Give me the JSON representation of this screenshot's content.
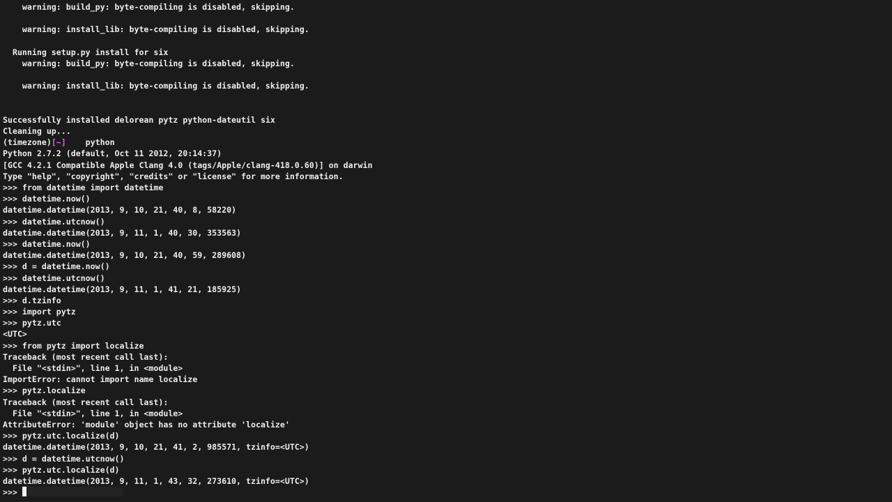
{
  "terminal": {
    "lines": [
      "    warning: build_py: byte-compiling is disabled, skipping.",
      "",
      "    warning: install_lib: byte-compiling is disabled, skipping.",
      "",
      "  Running setup.py install for six",
      "    warning: build_py: byte-compiling is disabled, skipping.",
      "",
      "    warning: install_lib: byte-compiling is disabled, skipping.",
      "",
      "",
      "Successfully installed delorean pytz python-dateutil six",
      "Cleaning up...",
      null,
      "Python 2.7.2 (default, Oct 11 2012, 20:14:37)",
      "[GCC 4.2.1 Compatible Apple Clang 4.0 (tags/Apple/clang-418.0.60)] on darwin",
      "Type \"help\", \"copyright\", \"credits\" or \"license\" for more information.",
      ">>> from datetime import datetime",
      ">>> datetime.now()",
      "datetime.datetime(2013, 9, 10, 21, 40, 8, 58220)",
      ">>> datetime.utcnow()",
      "datetime.datetime(2013, 9, 11, 1, 40, 30, 353563)",
      ">>> datetime.now()",
      "datetime.datetime(2013, 9, 10, 21, 40, 59, 289608)",
      ">>> d = datetime.now()",
      ">>> datetime.utcnow()",
      "datetime.datetime(2013, 9, 11, 1, 41, 21, 185925)",
      ">>> d.tzinfo",
      ">>> import pytz",
      ">>> pytz.utc",
      "<UTC>",
      ">>> from pytz import localize",
      "Traceback (most recent call last):",
      "  File \"<stdin>\", line 1, in <module>",
      "ImportError: cannot import name localize",
      ">>> pytz.localize",
      "Traceback (most recent call last):",
      "  File \"<stdin>\", line 1, in <module>",
      "AttributeError: 'module' object has no attribute 'localize'",
      ">>> pytz.utc.localize(d)",
      "datetime.datetime(2013, 9, 10, 21, 41, 2, 985571, tzinfo=<UTC>)",
      ">>> d = datetime.utcnow()",
      ">>> pytz.utc.localize(d)",
      "datetime.datetime(2013, 9, 11, 1, 43, 32, 273610, tzinfo=<UTC>)"
    ],
    "shell_prompt": {
      "env": "(timezone)",
      "dir": "[~]",
      "command": "    python"
    },
    "current_prompt": ">>> "
  },
  "colors": {
    "background": "#1b1b1b",
    "text": "#ededed",
    "prompt_dir": "#d966d9"
  }
}
